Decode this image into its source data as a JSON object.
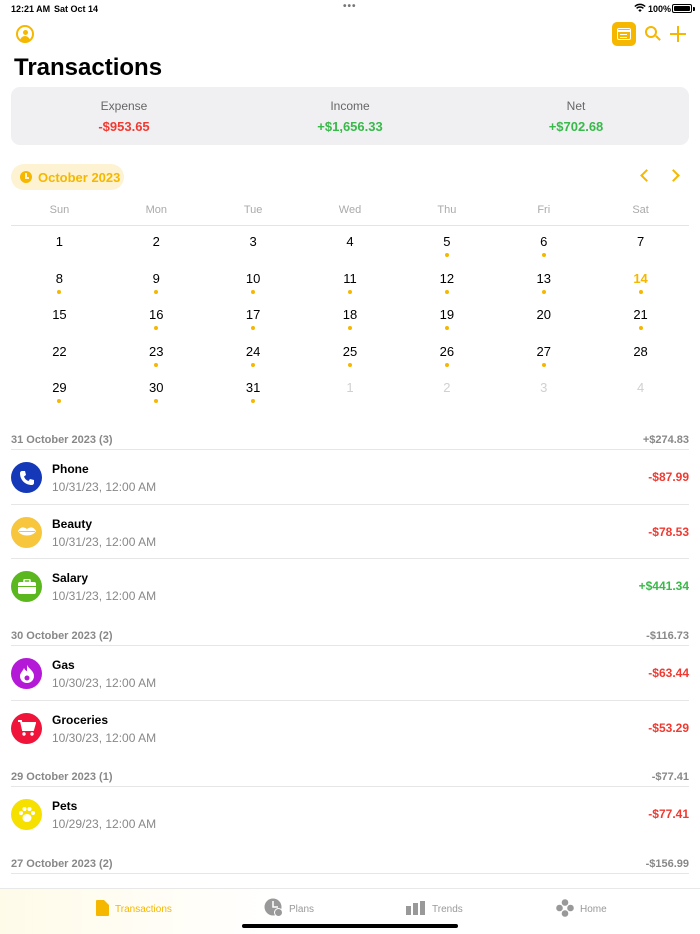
{
  "status_bar": {
    "time": "12:21 AM",
    "date": "Sat Oct 14",
    "battery": "100%"
  },
  "header": {
    "title": "Transactions",
    "icons": [
      "profile-icon",
      "calendar-icon",
      "search-icon",
      "plus-icon"
    ]
  },
  "summary": [
    {
      "label": "Expense",
      "value": "-$953.65",
      "tone": "negative"
    },
    {
      "label": "Income",
      "value": "+$1,656.33",
      "tone": "positive"
    },
    {
      "label": "Net",
      "value": "+$702.68",
      "tone": "positive"
    }
  ],
  "calendar": {
    "month_label": "October 2023",
    "weekdays": [
      "Sun",
      "Mon",
      "Tue",
      "Wed",
      "Thu",
      "Fri",
      "Sat"
    ],
    "days": [
      {
        "d": "1",
        "dot": false,
        "other": false
      },
      {
        "d": "2",
        "dot": false,
        "other": false
      },
      {
        "d": "3",
        "dot": false,
        "other": false
      },
      {
        "d": "4",
        "dot": false,
        "other": false
      },
      {
        "d": "5",
        "dot": true,
        "other": false
      },
      {
        "d": "6",
        "dot": true,
        "other": false
      },
      {
        "d": "7",
        "dot": false,
        "other": false
      },
      {
        "d": "8",
        "dot": true,
        "other": false
      },
      {
        "d": "9",
        "dot": true,
        "other": false
      },
      {
        "d": "10",
        "dot": true,
        "other": false
      },
      {
        "d": "11",
        "dot": true,
        "other": false
      },
      {
        "d": "12",
        "dot": true,
        "other": false
      },
      {
        "d": "13",
        "dot": true,
        "other": false
      },
      {
        "d": "14",
        "dot": true,
        "other": false,
        "today": true
      },
      {
        "d": "15",
        "dot": false,
        "other": false
      },
      {
        "d": "16",
        "dot": true,
        "other": false
      },
      {
        "d": "17",
        "dot": true,
        "other": false
      },
      {
        "d": "18",
        "dot": true,
        "other": false
      },
      {
        "d": "19",
        "dot": true,
        "other": false
      },
      {
        "d": "20",
        "dot": false,
        "other": false
      },
      {
        "d": "21",
        "dot": true,
        "other": false
      },
      {
        "d": "22",
        "dot": false,
        "other": false
      },
      {
        "d": "23",
        "dot": true,
        "other": false
      },
      {
        "d": "24",
        "dot": true,
        "other": false
      },
      {
        "d": "25",
        "dot": true,
        "other": false
      },
      {
        "d": "26",
        "dot": true,
        "other": false
      },
      {
        "d": "27",
        "dot": true,
        "other": false
      },
      {
        "d": "28",
        "dot": false,
        "other": false
      },
      {
        "d": "29",
        "dot": true,
        "other": false
      },
      {
        "d": "30",
        "dot": true,
        "other": false
      },
      {
        "d": "31",
        "dot": true,
        "other": false
      },
      {
        "d": "1",
        "dot": false,
        "other": true
      },
      {
        "d": "2",
        "dot": false,
        "other": true
      },
      {
        "d": "3",
        "dot": false,
        "other": true
      },
      {
        "d": "4",
        "dot": false,
        "other": true
      }
    ]
  },
  "sections": [
    {
      "title": "31 October 2023 (3)",
      "total": "+$274.83",
      "items": [
        {
          "name": "Phone",
          "date": "10/31/23, 12:00 AM",
          "amount": "-$87.99",
          "tone": "negative",
          "icon": "phone-icon",
          "color": "#1438b8"
        },
        {
          "name": "Beauty",
          "date": "10/31/23, 12:00 AM",
          "amount": "-$78.53",
          "tone": "negative",
          "icon": "lips-icon",
          "color": "#f7c63c"
        },
        {
          "name": "Salary",
          "date": "10/31/23, 12:00 AM",
          "amount": "+$441.34",
          "tone": "positive",
          "icon": "briefcase-icon",
          "color": "#5ab81e"
        }
      ]
    },
    {
      "title": "30 October 2023 (2)",
      "total": "-$116.73",
      "items": [
        {
          "name": "Gas",
          "date": "10/30/23, 12:00 AM",
          "amount": "-$63.44",
          "tone": "negative",
          "icon": "flame-icon",
          "color": "#b319d6"
        },
        {
          "name": "Groceries",
          "date": "10/30/23, 12:00 AM",
          "amount": "-$53.29",
          "tone": "negative",
          "icon": "cart-icon",
          "color": "#f0143a"
        }
      ]
    },
    {
      "title": "29 October 2023 (1)",
      "total": "-$77.41",
      "items": [
        {
          "name": "Pets",
          "date": "10/29/23, 12:00 AM",
          "amount": "-$77.41",
          "tone": "negative",
          "icon": "paw-icon",
          "color": "#f5e000"
        }
      ]
    },
    {
      "title": "27 October 2023 (2)",
      "total": "-$156.99",
      "items": []
    }
  ],
  "tab_bar": [
    {
      "label": "Transactions",
      "icon": "document-icon",
      "active": true
    },
    {
      "label": "Plans",
      "icon": "plans-icon",
      "active": false
    },
    {
      "label": "Trends",
      "icon": "bars-icon",
      "active": false
    },
    {
      "label": "Home",
      "icon": "home-dots-icon",
      "active": false
    }
  ],
  "colors": {
    "accent": "#f5b700",
    "negative": "#f03a31",
    "positive": "#38b94a"
  }
}
